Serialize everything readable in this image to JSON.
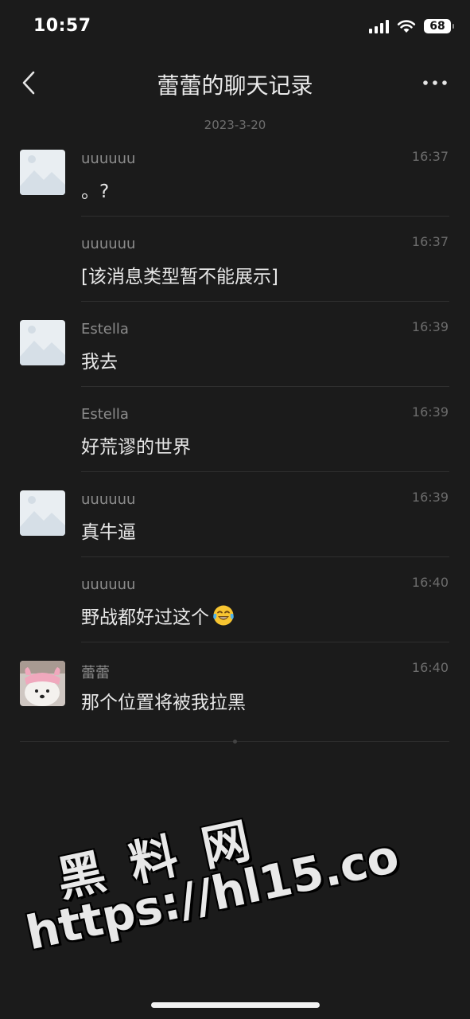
{
  "status_bar": {
    "time": "10:57",
    "battery": "68"
  },
  "nav": {
    "title": "蕾蕾的聊天记录"
  },
  "date_label": "2023-3-20",
  "messages": [
    {
      "name": "uuuuuu",
      "time": "16:37",
      "text": "。?",
      "avatar": "placeholder-image"
    },
    {
      "name": "uuuuuu",
      "time": "16:37",
      "text": "[该消息类型暂不能展示]",
      "avatar": "none"
    },
    {
      "name": "Estella",
      "time": "16:39",
      "text": "我去",
      "avatar": "placeholder-image"
    },
    {
      "name": "Estella",
      "time": "16:39",
      "text": "好荒谬的世界",
      "avatar": "none"
    },
    {
      "name": "uuuuuu",
      "time": "16:39",
      "text": "真牛逼",
      "avatar": "placeholder-image"
    },
    {
      "name": "uuuuuu",
      "time": "16:40",
      "text": "野战都好过这个",
      "emoji": "tears-of-joy-emoji",
      "avatar": "none"
    },
    {
      "name": "蕾蕾",
      "time": "16:40",
      "text": "那个位置将被我拉黑",
      "avatar": "dog-photo"
    }
  ],
  "watermark": {
    "line1": "黑 料 网",
    "line2": "https://hl15.co"
  },
  "colors": {
    "background": "#1b1b1b",
    "text": "#e8e8e8",
    "muted": "#8c8c8c"
  }
}
